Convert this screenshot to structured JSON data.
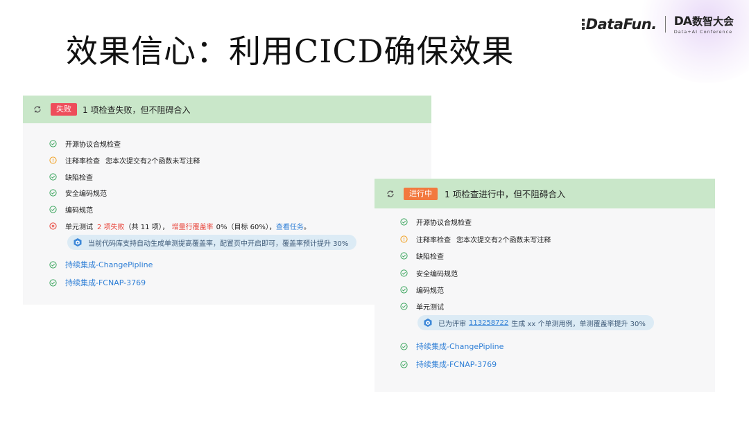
{
  "slide": {
    "title": "效果信心：利用CICD确保效果",
    "logo_datafun": "DataFun.",
    "logo_da": "DA",
    "logo_conf_cn": "数智大会",
    "logo_conf_en": "Data+AI Conference"
  },
  "left_panel": {
    "badge": "失败",
    "header": "1 项检查失败，但不阻碍合入",
    "items": [
      {
        "status": "pass",
        "name": "开源协议合规检查",
        "extra": ""
      },
      {
        "status": "warning",
        "name": "注释率检查",
        "extra": "您本次提交有2个函数未写注释"
      },
      {
        "status": "pass",
        "name": "缺陷检查",
        "extra": ""
      },
      {
        "status": "pass",
        "name": "安全编码规范",
        "extra": ""
      },
      {
        "status": "pass",
        "name": "编码规范",
        "extra": ""
      }
    ],
    "unit_test": {
      "name": "单元测试",
      "failed": "2 项失败",
      "total": "（共 11 项），",
      "coverage_label": "增量行覆盖率",
      "coverage_value": "0%（目标 60%），",
      "view_task": "查看任务",
      "period": "。"
    },
    "tip": "当前代码库支持自动生成单测提高覆盖率，配置页中开启即可，覆盖率预计提升 30%",
    "links": [
      {
        "status": "pass",
        "name": "持续集成-ChangePipline"
      },
      {
        "status": "pass",
        "name": "持续集成-FCNAP-3769"
      }
    ]
  },
  "right_panel": {
    "badge": "进行中",
    "header": "1 项检查进行中，但不阻碍合入",
    "items": [
      {
        "status": "pass",
        "name": "开源协议合规检查",
        "extra": ""
      },
      {
        "status": "warning",
        "name": "注释率检查",
        "extra": "您本次提交有2个函数未写注释"
      },
      {
        "status": "pass",
        "name": "缺陷检查",
        "extra": ""
      },
      {
        "status": "pass",
        "name": "安全编码规范",
        "extra": ""
      },
      {
        "status": "pass",
        "name": "编码规范",
        "extra": ""
      },
      {
        "status": "pass",
        "name": "单元测试",
        "extra": ""
      }
    ],
    "tip": {
      "prefix": "已为评审",
      "review_id": "113258722",
      "suffix": "生成 xx 个单测用例，单测覆盖率提升 30%"
    },
    "links": [
      {
        "status": "pass",
        "name": "持续集成-ChangePipline"
      },
      {
        "status": "pass",
        "name": "持续集成-FCNAP-3769"
      }
    ]
  },
  "colors": {
    "header_bg": "#c9e7c9",
    "panel_bg": "#f7f7f8",
    "fail_badge": "#ee4c5a",
    "running_badge": "#f2793f",
    "pass": "#3aa55d",
    "warning": "#f0a020",
    "error": "#e8443a",
    "link": "#2f7fd6",
    "tip_bg": "#dcebf5"
  }
}
